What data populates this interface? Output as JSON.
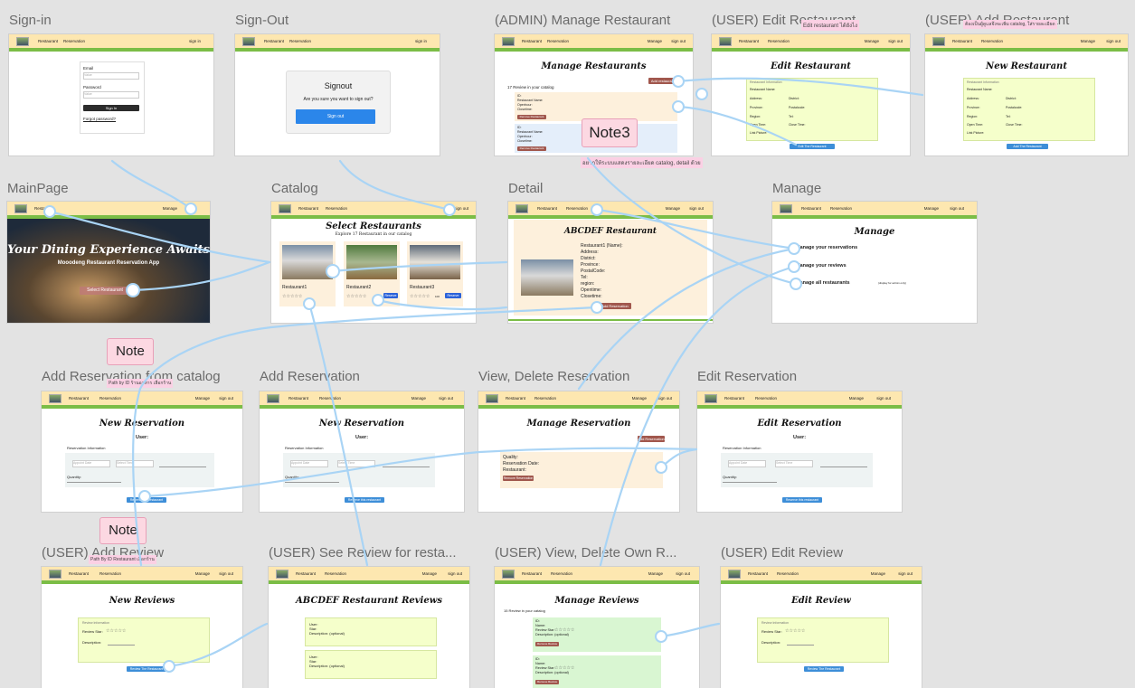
{
  "nav": {
    "restaurant": "Restaurant",
    "reservation": "Reservation",
    "manage": "Manage",
    "sign_in": "sign in",
    "sign_out": "sign out"
  },
  "frames": {
    "signin": {
      "label": "Sign-in",
      "email_label": "Email",
      "email_placeholder": "Value",
      "password_label": "Password",
      "password_placeholder": "Value",
      "button": "Sign In",
      "forgot": "Forgot password?"
    },
    "signout": {
      "label": "Sign-Out",
      "title": "Signout",
      "question": "Are you sure you want to sign out?",
      "button": "Sign out"
    },
    "admin_manage": {
      "label": "(ADMIN) Manage Restaurant",
      "title": "Manage Restaurants",
      "count": "17 Review in your catalog",
      "add_button": "Add restaurant",
      "item_lines": [
        "ID:",
        "Restaurant Name:",
        "Openhour:",
        "Closetime:",
        "etc."
      ],
      "remove_button": "Remove Restaurant"
    },
    "edit_restaurant": {
      "label": "(USER) Edit Restaurant",
      "title": "Edit Restaurant",
      "section": "Restaurant Information",
      "fields": [
        "Restaurant Name:",
        "Address:",
        "District:",
        "Province:",
        "Postalcode:",
        "Region:",
        "Tel:",
        "Open Time:",
        "Close Time:",
        "Link Picture:"
      ],
      "button": "Edit The Restaurant",
      "tag": "Edit restaurant ได้ยังไง"
    },
    "add_restaurant": {
      "label": "(USER) Add Restaurant",
      "title": "New Restaurant",
      "section": "Restaurant Information",
      "button": "Add The Restaurant",
      "tag": "ต้องเป็นผู้ดูแลจึงจะเพิ่ม catalog, ใส่รายละเอียด"
    },
    "mainpage": {
      "label": "MainPage",
      "hero_title": "Your Dining Experience Awaits",
      "hero_sub": "Mooodeng Restaurant Reservation App",
      "button": "Select Restaurant"
    },
    "catalog": {
      "label": "Catalog",
      "title": "Select Restaurants",
      "subtitle": "Explore 17 Restaurant in our catalog",
      "items": [
        {
          "name": "Restaurant1",
          "stars": "☆☆☆☆☆",
          "count": "100"
        },
        {
          "name": "Restaurant2",
          "stars": "☆☆☆☆☆",
          "count": "100"
        },
        {
          "name": "Restaurant3",
          "stars": "☆☆☆☆☆",
          "count": "100"
        }
      ],
      "button": "Reserve"
    },
    "detail": {
      "label": "Detail",
      "title": "ABCDEF Restaurant",
      "lines": [
        "Restaurant1 (Name):",
        "Address:",
        "District:",
        "Province:",
        "PostalCode:",
        "Tel:",
        "region:",
        "Opentime:",
        "Closetime:"
      ],
      "button": "Add Reservation"
    },
    "manage": {
      "label": "Manage",
      "title": "Manage",
      "items": [
        "Manage your reservations",
        "Manage your reviews",
        "Manage all restaurants"
      ],
      "admin_note": "(display for admin only)"
    },
    "add_res_catalog": {
      "label": "Add Reservation from catalog",
      "title": "New Reservation",
      "user": "User:",
      "section": "Reservation Information",
      "date_ph": "Appoint Date",
      "time_ph": "Select Time",
      "quantity": "Quantity:",
      "button": "Reserve this restaurant",
      "tag": "Path by ID ร้านอาหาร เลือกร้าน"
    },
    "add_res": {
      "label": "Add Reservation",
      "title": "New Reservation",
      "user": "User:",
      "section": "Reservation Information",
      "date_ph": "Appoint Date",
      "time_ph": "Select Time",
      "quantity": "Quantity:",
      "button": "Reserve this restaurant"
    },
    "view_res": {
      "label": "View, Delete Reservation",
      "title": "Manage Reservation",
      "add_button": "Add Reservation",
      "lines": [
        "Quality:",
        "Reservation Date:",
        "Restaurant:"
      ],
      "remove_button": "Remove Reservation"
    },
    "edit_res": {
      "label": "Edit Reservation",
      "title": "Edit Reservation",
      "user": "User:",
      "section": "Reservation Information",
      "date_ph": "Appoint Date",
      "time_ph": "Select Time",
      "quantity": "Quantity:",
      "button": "Reserve this restaurant"
    },
    "add_review": {
      "label": "(USER) Add Review",
      "title": "New Reviews",
      "section": "Review Information",
      "star_label": "Review Star:",
      "stars": "☆☆☆☆☆",
      "desc": "Description:",
      "button": "Review The Restaurant",
      "tag": "Path By ID Restaurant เลือกร้าน"
    },
    "see_review": {
      "label": "(USER) See Review for resta...",
      "title": "ABCDEF Restaurant Reviews",
      "lines": [
        "User:",
        "Star:",
        "Description: (optional)"
      ]
    },
    "view_review": {
      "label": "(USER) View, Delete Own R...",
      "title": "Manage Reviews",
      "count": "15 Review in your catalog",
      "lines": [
        "ID:",
        "Name:",
        "Review Star:",
        "Description: (optional)"
      ],
      "stars": "☆☆☆☆☆",
      "remove_button": "Remove Review"
    },
    "edit_review": {
      "label": "(USER) Edit Review",
      "title": "Edit Review",
      "section": "Review Information",
      "star_label": "Review Star:",
      "stars": "☆☆☆☆☆",
      "desc": "Description:",
      "button": "Review The Restaurant"
    }
  },
  "notes": {
    "note1": "Note",
    "note2": "Note",
    "note3": "Note3",
    "note3_tag": "อยากให้ระบบแสดงรายละเอียด catalog, detail ด้วย"
  },
  "colors": {
    "nav": "#fde7b0",
    "nav_border": "#7bbd46",
    "blue_button": "#3d8ed8",
    "brown_button": "#a1574d",
    "connector": "#a9d4f5",
    "note_bg": "#fcd8e2"
  }
}
